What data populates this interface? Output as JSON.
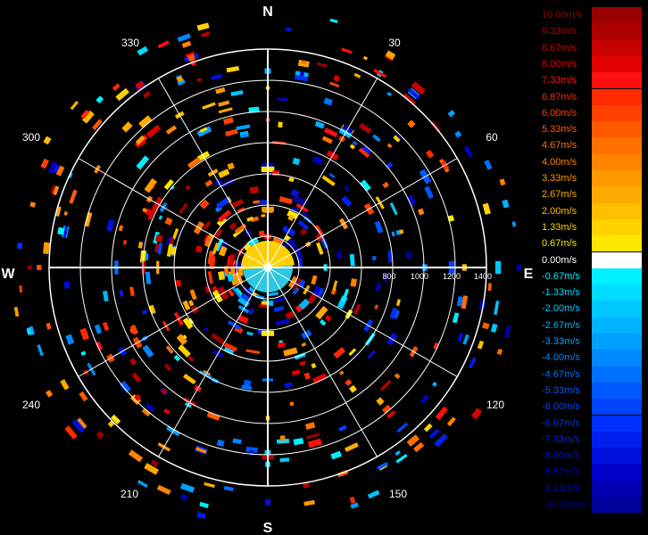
{
  "compass": {
    "north": "N",
    "south": "S",
    "east": "E",
    "west": "W"
  },
  "angle_labels": [
    "30",
    "60",
    "120",
    "150",
    "210",
    "240",
    "300",
    "330"
  ],
  "range_labels": [
    "800",
    "1000",
    "1200",
    "1400"
  ],
  "legend": {
    "entries": [
      {
        "label": "10.00m/s",
        "color": "#9b0000"
      },
      {
        "label": "9.33m/s",
        "color": "#af0000"
      },
      {
        "label": "8.67m/s",
        "color": "#c80000"
      },
      {
        "label": "8.00m/s",
        "color": "#e10000"
      },
      {
        "label": "7.33m/s",
        "color": "#ff0f0f"
      },
      {
        "label": "6.87m/s",
        "color": "#ff2a00"
      },
      {
        "label": "6.00m/s",
        "color": "#ff4000"
      },
      {
        "label": "5.33m/s",
        "color": "#ff5a00"
      },
      {
        "label": "4.67m/s",
        "color": "#ff7000"
      },
      {
        "label": "4.00m/s",
        "color": "#ff8400"
      },
      {
        "label": "3.33m/s",
        "color": "#ff9900"
      },
      {
        "label": "2.67m/s",
        "color": "#ffaa00"
      },
      {
        "label": "2.00m/s",
        "color": "#ffbe00"
      },
      {
        "label": "1.33m/s",
        "color": "#ffd200"
      },
      {
        "label": "0.67m/s",
        "color": "#ffe600"
      },
      {
        "label": "0.00m/s",
        "color": "#ffffff"
      },
      {
        "label": "-0.67m/s",
        "color": "#00f0ff"
      },
      {
        "label": "-1.33m/s",
        "color": "#00dcff"
      },
      {
        "label": "-2.00m/s",
        "color": "#00c8ff"
      },
      {
        "label": "-2.67m/s",
        "color": "#00b4ff"
      },
      {
        "label": "-3.33m/s",
        "color": "#00a0ff"
      },
      {
        "label": "-4.00m/s",
        "color": "#0088ff"
      },
      {
        "label": "-4.67m/s",
        "color": "#0070ff"
      },
      {
        "label": "-5.33m/s",
        "color": "#0058ff"
      },
      {
        "label": "-6.00m/s",
        "color": "#0044ff"
      },
      {
        "label": "-6.67m/s",
        "color": "#0030ff"
      },
      {
        "label": "-7.33m/s",
        "color": "#0020f0"
      },
      {
        "label": "-8.00m/s",
        "color": "#0010dc"
      },
      {
        "label": "-8.67m/s",
        "color": "#0000c8"
      },
      {
        "label": "-9.33m/s",
        "color": "#0000b0"
      },
      {
        "label": "-10.00m/s",
        "color": "#00009a"
      }
    ]
  },
  "colors": {
    "background": "#000000",
    "grid": "#ffffff",
    "positive": "#ff9900",
    "negative": "#0060ff",
    "core_positive": "#ffd000",
    "core_negative": "#30c8e0"
  }
}
